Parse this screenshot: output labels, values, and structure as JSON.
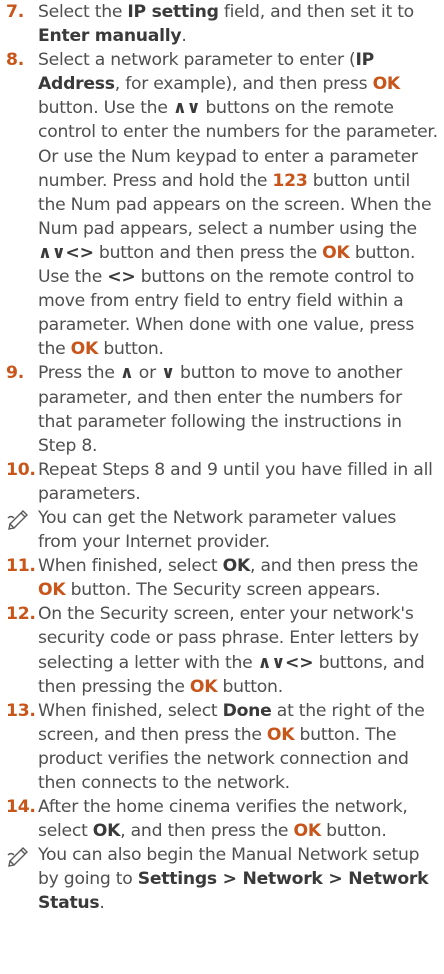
{
  "steps": [
    {
      "num": "7.",
      "t1": "Select the ",
      "b1": "IP setting",
      "t2": " field, and then set it to ",
      "b2": "Enter manually",
      "t3": "."
    },
    {
      "num": "8.",
      "t1": "Select a network parameter to enter (",
      "b1": "IP Address",
      "t2": ", for example), and then press ",
      "ok1": "OK",
      "t3": " button. Use the ",
      "arr1": "∧∨",
      "t4": " buttons on the remote control to enter the numbers for the parameter. Or use the Num keypad to enter a parameter number. Press and hold the ",
      "b2": "123",
      "t5": " button until the Num pad appears on the screen. When the Num pad appears, select a number using the ",
      "arr2": "∧∨<>",
      "t6": " button and then press the ",
      "ok2": "OK",
      "t7": " button. Use the ",
      "arr3": "<>",
      "t8": " buttons on the remote control to move from entry field to entry field within a parameter. When done with one value, press the ",
      "ok3": "OK",
      "t9": " button."
    },
    {
      "num": "9.",
      "t1": "Press the ",
      "arr1": "∧",
      "t2": " or ",
      "arr2": "∨",
      "t3": " button to move to another parameter, and then enter the numbers for that parameter following the instructions in Step 8."
    },
    {
      "num": "10.",
      "t1": "Repeat Steps 8 and 9 until you have filled in all parameters."
    },
    {
      "num": "11.",
      "t1": "When finished, select ",
      "b1": "OK",
      "t2": ", and then press the ",
      "ok1": "OK",
      "t3": " button. The Security screen appears."
    },
    {
      "num": "12.",
      "t1": "On the Security screen, enter your network's security code or pass phrase. Enter letters by selecting a letter with the ",
      "arr1": "∧∨<>",
      "t2": " buttons, and then pressing the ",
      "ok1": "OK",
      "t3": " button."
    },
    {
      "num": "13.",
      "t1": "When finished, select ",
      "b1": "Done",
      "t2": " at the right of the screen, and then press the ",
      "ok1": "OK",
      "t3": " button. The product verifies the network connection and then connects to the network."
    },
    {
      "num": "14.",
      "t1": "After the home cinema verifies the network, select ",
      "b1": "OK",
      "t2": ", and then press the ",
      "ok1": "OK",
      "t3": " button."
    }
  ],
  "notes": [
    {
      "icon": "pencil-note-icon",
      "text": "You can get the Network parameter values from your Internet provider."
    },
    {
      "icon": "pencil-note-icon",
      "t1": "You can also begin the Manual Network setup by going to ",
      "b1": "Settings",
      "sep1": " > ",
      "b2": "Network",
      "sep2": " > ",
      "b3": "Network Status",
      "t2": "."
    }
  ],
  "colors": {
    "accent": "#c8551a",
    "text": "#4f4f4f",
    "bold": "#3a3a3a"
  }
}
